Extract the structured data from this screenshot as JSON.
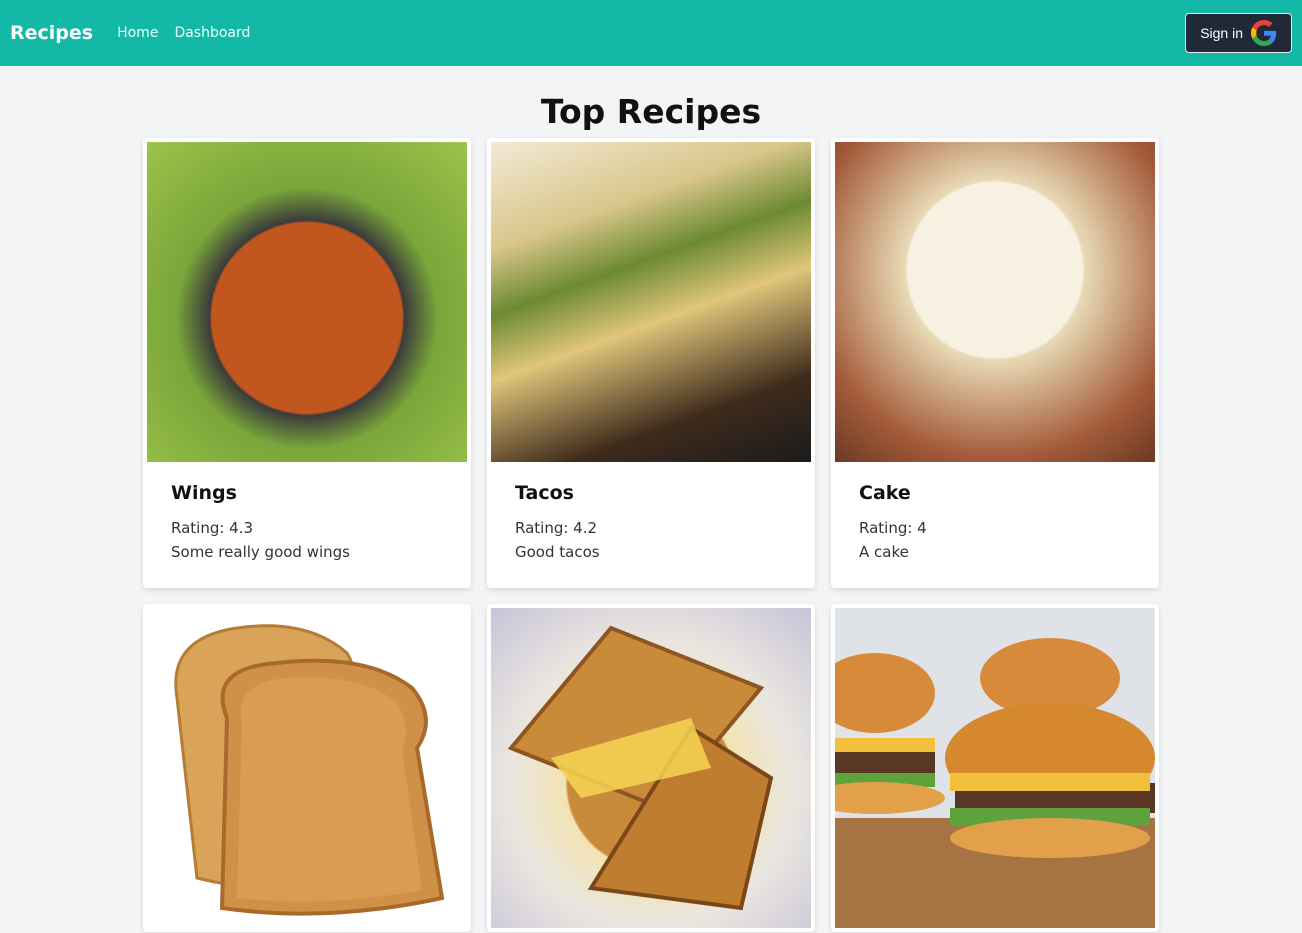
{
  "navbar": {
    "brand": "Recipes",
    "links": [
      "Home",
      "Dashboard"
    ],
    "signin_label": "Sign in",
    "accent": "#13b8a6"
  },
  "page": {
    "title": "Top Recipes"
  },
  "recipes": [
    {
      "title": "Wings",
      "rating": "Rating: 4.3",
      "description": "Some really good wings",
      "image": "chicken-wings-photo"
    },
    {
      "title": "Tacos",
      "rating": "Rating: 4.2",
      "description": "Good tacos",
      "image": "tacos-photo"
    },
    {
      "title": "Cake",
      "rating": "Rating: 4",
      "description": "A cake",
      "image": "layer-cake-photo"
    },
    {
      "image": "toast-photo"
    },
    {
      "image": "grilled-cheese-photo"
    },
    {
      "image": "cheeseburgers-photo"
    }
  ]
}
